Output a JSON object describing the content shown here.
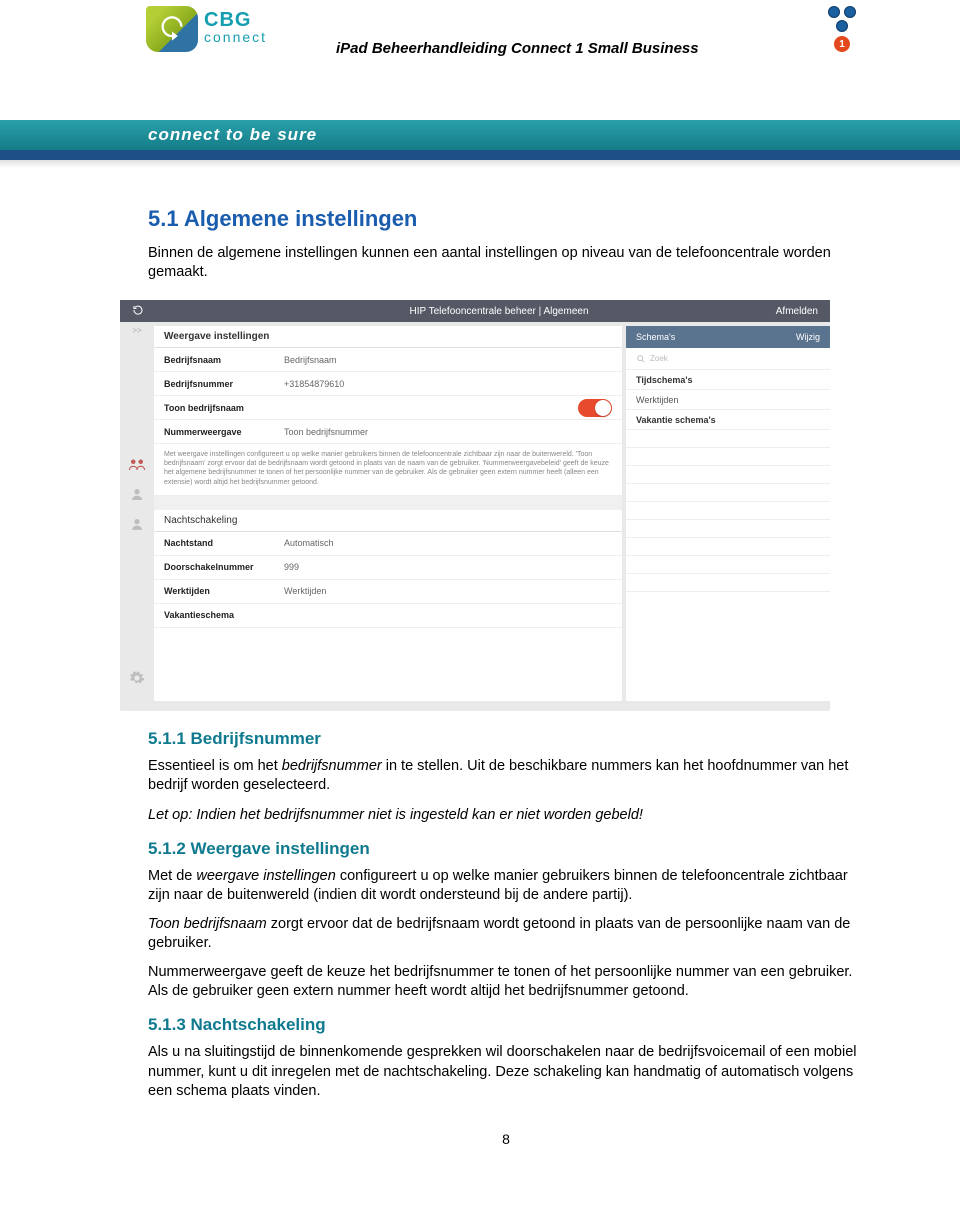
{
  "header": {
    "logo_top": "CBG",
    "logo_bottom": "connect",
    "doc_title": "iPad Beheerhandleiding Connect 1 Small Business",
    "badge": "1",
    "tagline": "connect to be sure"
  },
  "section": {
    "h_5_1": "5.1 Algemene instellingen",
    "p_5_1": "Binnen de algemene instellingen kunnen een aantal instellingen op niveau van de telefooncentrale worden gemaakt.",
    "h_5_1_1": "5.1.1 Bedrijfsnummer",
    "p_5_1_1a": "Essentieel is om het ",
    "p_5_1_1a_i": "bedrijfsnummer",
    "p_5_1_1a_tail": " in te stellen. Uit de beschikbare nummers kan het hoofdnummer van het bedrijf worden geselecteerd.",
    "p_5_1_1b": "Let op: Indien het bedrijfsnummer niet is ingesteld kan er niet worden gebeld!",
    "h_5_1_2": "5.1.2 Weergave instellingen",
    "p_5_1_2a_pre": "Met de ",
    "p_5_1_2a_i": "weergave instellingen",
    "p_5_1_2a_tail": " configureert u op welke manier gebruikers binnen de telefooncentrale zichtbaar zijn naar de buitenwereld (indien dit wordt ondersteund bij de andere partij).",
    "p_5_1_2b_i": "Toon bedrijfsnaam",
    "p_5_1_2b_tail": " zorgt ervoor dat de bedrijfsnaam wordt getoond in plaats van de persoonlijke naam van de gebruiker.",
    "p_5_1_2c": "Nummerweergave geeft de keuze het bedrijfsnummer te tonen of het persoonlijke nummer van een gebruiker. Als de gebruiker geen extern nummer heeft wordt altijd het bedrijfsnummer getoond.",
    "h_5_1_3": "5.1.3 Nachtschakeling",
    "p_5_1_3": "Als u na sluitingstijd de binnenkomende gesprekken wil doorschakelen naar de bedrijfsvoicemail of een mobiel nummer, kunt u dit inregelen met de nachtschakeling. Deze schakeling kan handmatig of automatisch volgens een schema plaats vinden."
  },
  "shot": {
    "topbar_title": "HIP Telefooncentrale beheer | Algemeen",
    "topbar_action": "Afmelden",
    "expand": ">>",
    "left": {
      "head": "Weergave instellingen",
      "rows": [
        {
          "k": "Bedrijfsnaam",
          "v": "Bedrijfsnaam"
        },
        {
          "k": "Bedrijfsnummer",
          "v": "+31854879610"
        },
        {
          "k": "Toon bedrijfsnaam",
          "v": "",
          "toggle": true
        },
        {
          "k": "Nummerweergave",
          "v": "Toon bedrijfsnummer"
        }
      ],
      "desc": "Met weergave instellingen configureert u op welke manier gebruikers binnen de telefooncentrale zichtbaar zijn naar de buitenwereld. 'Toon bedrijfsnaam' zorgt ervoor dat de bedrijfsnaam wordt getoond in plaats van de naam van de gebruiker. 'Nummerweergavebeleid' geeft de keuze het algemene bedrijfsnummer te tonen of het persoonlijke nummer van de gebruiker. Als de gebruiker geen extern nummer heeft (alleen een extensie) wordt altijd het bedrijfsnummer getoond.",
      "sec2": "Nachtschakeling",
      "rows2": [
        {
          "k": "Nachtstand",
          "v": "Automatisch"
        },
        {
          "k": "Doorschakelnummer",
          "v": "999"
        },
        {
          "k": "Werktijden",
          "v": "Werktijden"
        },
        {
          "k": "Vakantieschema",
          "v": ""
        }
      ]
    },
    "right": {
      "head_l": "Schema's",
      "head_r": "Wijzig",
      "search": "Zoek",
      "rows": [
        "Tijdschema's",
        "Werktijden",
        "Vakantie schema's"
      ]
    }
  },
  "page_num": "8"
}
